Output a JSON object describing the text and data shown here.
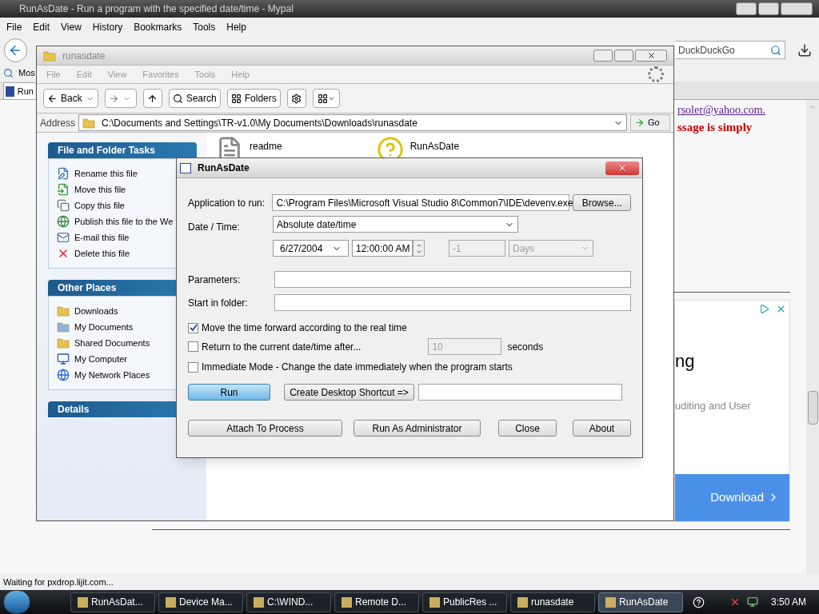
{
  "browser": {
    "title": "RunAsDate - Run a program with the specified date/time - Mypal",
    "menu": [
      "File",
      "Edit",
      "View",
      "History",
      "Bookmarks",
      "Tools",
      "Help"
    ],
    "search": {
      "placeholder": "DuckDuckGo"
    },
    "bookmark": "Mos",
    "tab": "Run",
    "page": {
      "link": "rsoler@yahoo.com.",
      "notice": "ssage is simply"
    },
    "ad": {
      "heading": "ng",
      "text": "uditing and User",
      "button": "Download"
    },
    "status": "Waiting for pxdrop.lijit.com..."
  },
  "explorer": {
    "title": "runasdate",
    "menu": [
      "File",
      "Edit",
      "View",
      "Favorites",
      "Tools",
      "Help"
    ],
    "toolbar": {
      "back": "Back",
      "search": "Search",
      "folders": "Folders"
    },
    "address_label": "Address",
    "address": "C:\\Documents and Settings\\TR-v1.0\\My Documents\\Downloads\\runasdate",
    "go": "Go",
    "panels": [
      {
        "title": "File and Folder Tasks",
        "items": [
          "Rename this file",
          "Move this file",
          "Copy this file",
          "Publish this file to the We",
          "E-mail this file",
          "Delete this file"
        ]
      },
      {
        "title": "Other Places",
        "items": [
          "Downloads",
          "My Documents",
          "Shared Documents",
          "My Computer",
          "My Network Places"
        ]
      },
      {
        "title": "Details"
      }
    ],
    "files": [
      {
        "name": "readme"
      },
      {
        "name": "RunAsDate"
      }
    ]
  },
  "dialog": {
    "title": "RunAsDate",
    "app_label": "Application to run:",
    "app_value": "C:\\Program Files\\Microsoft Visual Studio 8\\Common7\\IDE\\devenv.exe",
    "browse": "Browse...",
    "date_label": "Date / Time:",
    "mode": "Absolute date/time",
    "date": "6/27/2004",
    "time": "12:00:00 AM",
    "offset": {
      "value": "-1",
      "disabled": true
    },
    "unit": {
      "value": "Days",
      "disabled": true
    },
    "params_label": "Parameters:",
    "start_label": "Start in folder:",
    "options": [
      {
        "label": "Move the time forward according to the real time",
        "checked": true
      },
      {
        "label": "Return to the current date/time after...",
        "checked": false
      },
      {
        "label": "Immediate Mode - Change the date immediately when the program starts",
        "checked": false
      }
    ],
    "seconds": {
      "value": "10",
      "disabled": true,
      "unit": "seconds"
    },
    "run": {
      "label": "Run",
      "highlighted": true
    },
    "shortcut": "Create Desktop Shortcut =>",
    "buttons": [
      "Attach To Process",
      "Run As Administrator",
      "Close",
      "About"
    ]
  },
  "taskbar": {
    "items": [
      {
        "label": "RunAsDat...",
        "selected": false
      },
      {
        "label": "Device Ma...",
        "selected": false
      },
      {
        "label": "C:\\WIND...",
        "selected": false
      },
      {
        "label": "Remote D...",
        "selected": false
      },
      {
        "label": "PublicRes ...",
        "selected": false
      },
      {
        "label": "runasdate",
        "selected": false
      },
      {
        "label": "RunAsDate",
        "selected": true
      }
    ],
    "clock": "3:50 AM"
  }
}
